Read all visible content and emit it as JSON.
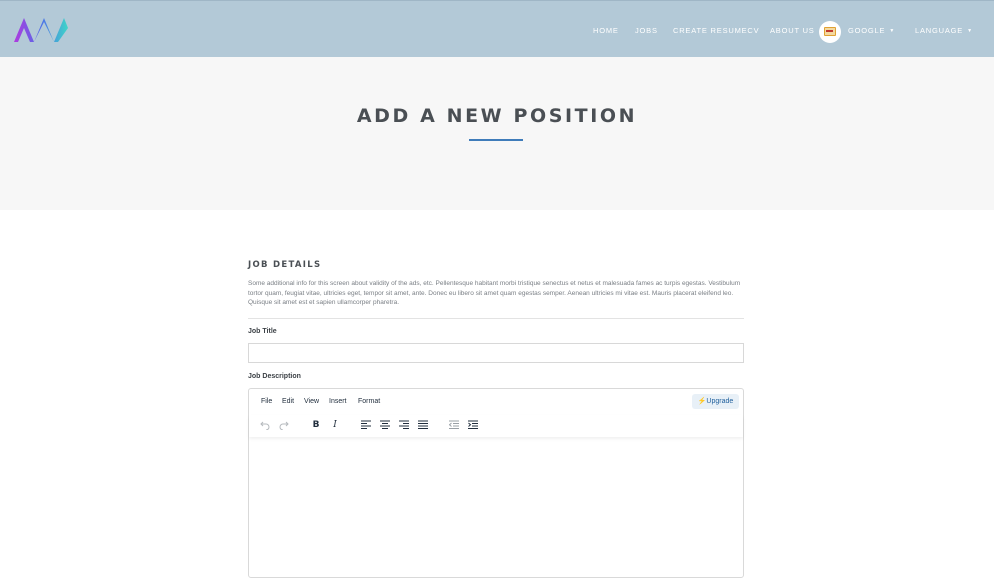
{
  "header": {
    "nav": [
      {
        "label": "HOME"
      },
      {
        "label": "JOBS"
      },
      {
        "label": "CREATE RESUMECV"
      },
      {
        "label": "ABOUT US"
      }
    ],
    "user_label": "GOOGLE",
    "language_label": "LANGUAGE",
    "icons": [
      "app-logo-icon",
      "avatar-icon",
      "caret-down-icon"
    ]
  },
  "hero": {
    "title": "ADD A NEW POSITION",
    "accent_color": "#3f7cba"
  },
  "form": {
    "section_title": "JOB DETAILS",
    "section_description": "Some additional info for this screen about validity of the ads, etc. Pellentesque habitant morbi tristique senectus et netus et malesuada fames ac turpis egestas. Vestibulum tortor quam, feugiat vitae, ultricies eget, tempor sit amet, ante. Donec eu libero sit amet quam egestas semper. Aenean ultricies mi vitae est. Mauris placerat eleifend leo. Quisque sit amet est et sapien ullamcorper pharetra.",
    "job_title_label": "Job Title",
    "job_title_value": "",
    "job_description_label": "Job Description",
    "editor": {
      "menu": [
        "File",
        "Edit",
        "View",
        "Insert",
        "Format"
      ],
      "upgrade_label": "⚡Upgrade",
      "toolbar_icons": [
        "undo-icon",
        "redo-icon",
        "bold-icon",
        "italic-icon",
        "align-left-icon",
        "align-center-icon",
        "align-right-icon",
        "align-justify-icon",
        "outdent-icon",
        "indent-icon"
      ],
      "bold_glyph": "B",
      "italic_glyph": "I"
    }
  },
  "colors": {
    "navbar_bg": "#b3c9d7",
    "hero_bg": "#f7f7f7",
    "heading_text": "#4a4f54"
  }
}
